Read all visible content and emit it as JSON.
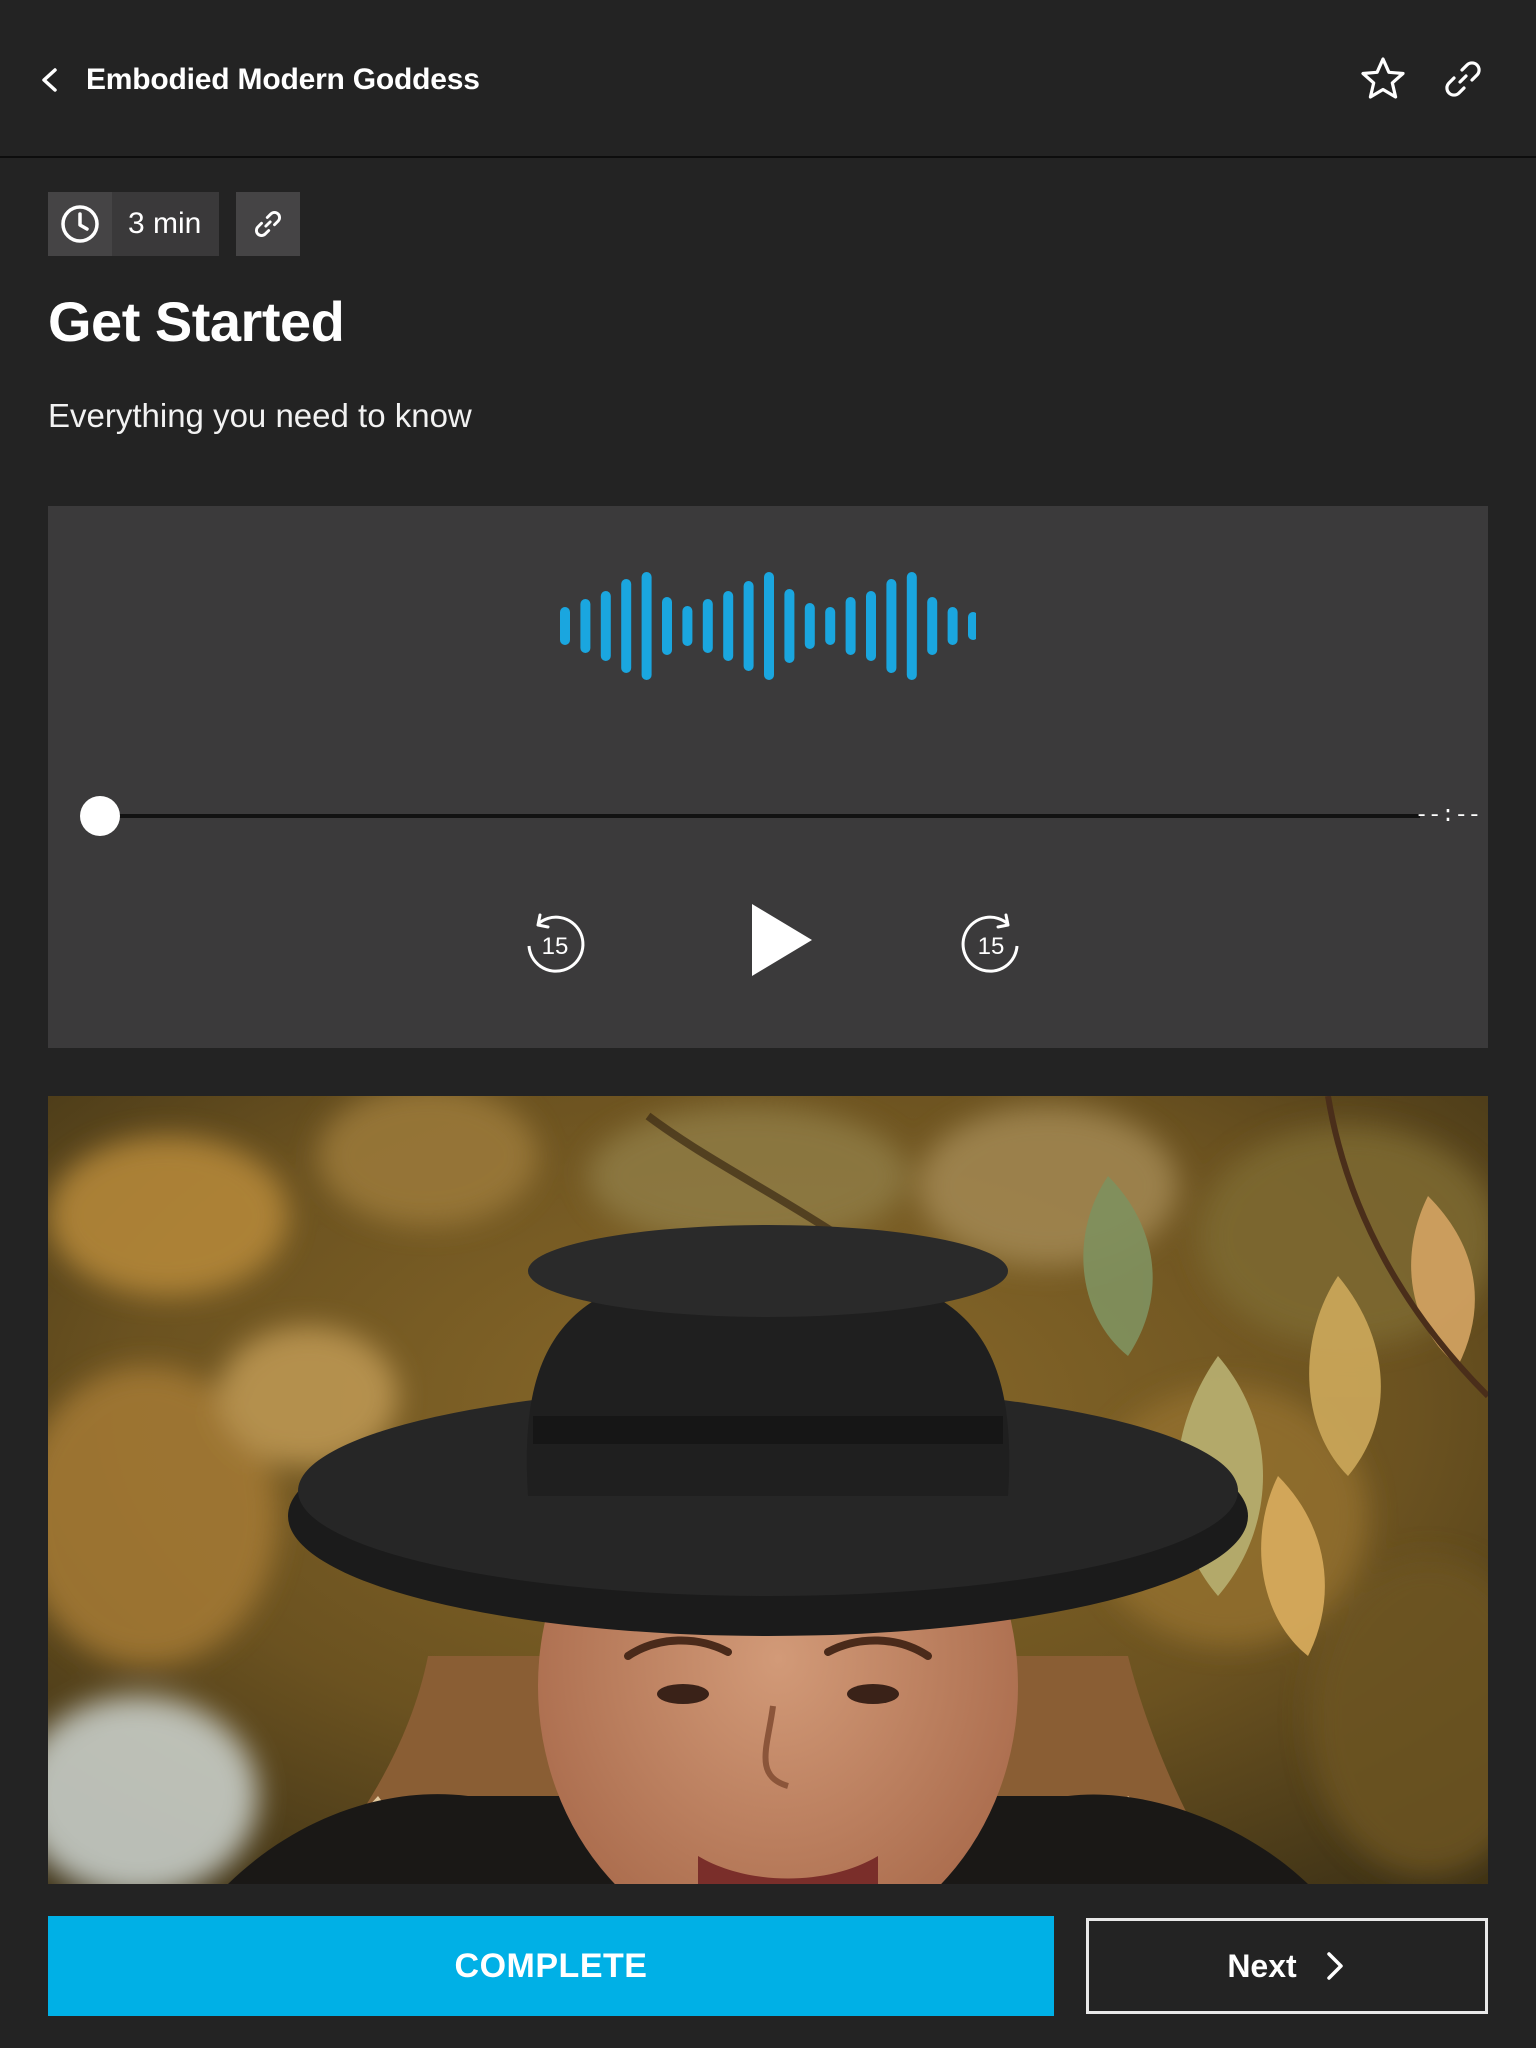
{
  "header": {
    "title": "Embodied Modern Goddess",
    "back_icon": "chevron-left-icon",
    "favorite_icon": "star-outline-icon",
    "share_icon": "link-icon"
  },
  "lesson": {
    "duration": "3 min",
    "title": "Get Started",
    "subtitle": "Everything you need to know"
  },
  "player": {
    "time": "--:--",
    "progress_fraction": 0,
    "rewind_seconds": "15",
    "forward_seconds": "15",
    "accent_color": "#1aa6df"
  },
  "actions": {
    "complete_label": "COMPLETE",
    "next_label": "Next",
    "complete_color": "#00b0e6"
  }
}
